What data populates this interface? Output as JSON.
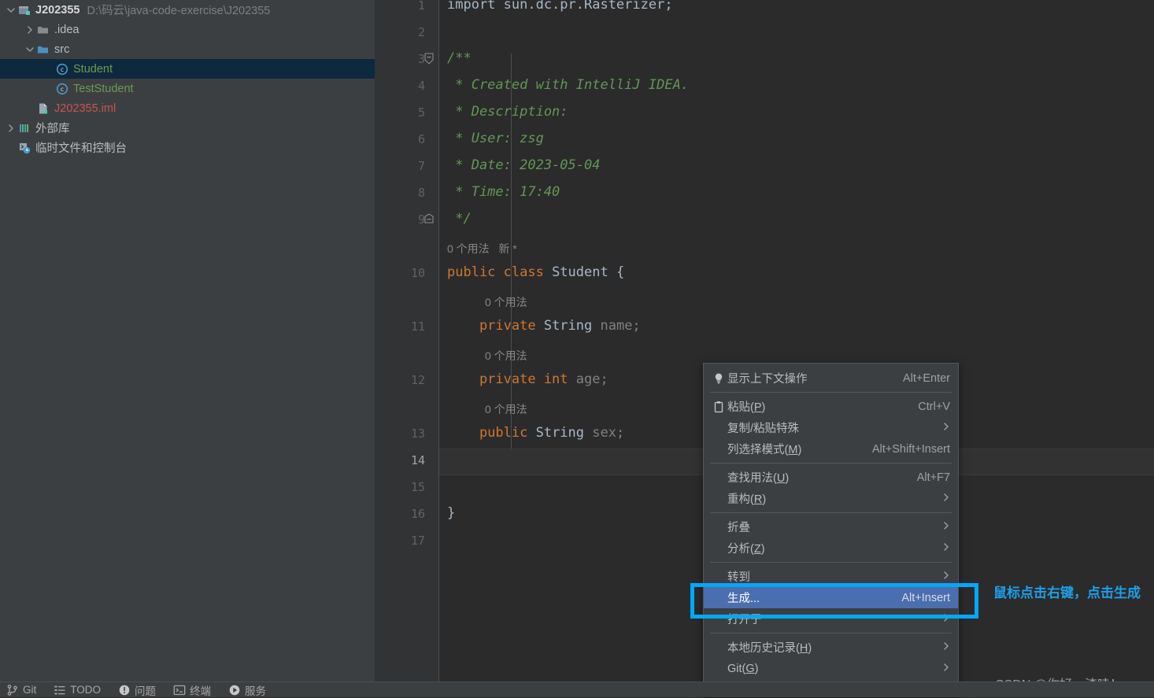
{
  "theme": {
    "editor_bg": "#2b2b2b",
    "panel_bg": "#3c3f41",
    "gutter_bg": "#313335",
    "selection_bg": "#0d293e",
    "menu_highlight": "#4b6eaf",
    "annotation_color": "#1e9fe8",
    "comment_green": "#629755",
    "keyword_orange": "#cc7832"
  },
  "sidebar": {
    "items": [
      {
        "label": "J202355",
        "sub": "D:\\码云\\java-code-exercise\\J202355",
        "icon": "module-icon",
        "arrow": "expanded",
        "indent": 0,
        "style": "bold",
        "selected": false
      },
      {
        "label": ".idea",
        "sub": "",
        "icon": "folder-icon",
        "arrow": "collapsed",
        "indent": 1,
        "style": "normal",
        "selected": false
      },
      {
        "label": "src",
        "sub": "",
        "icon": "source-folder-icon",
        "arrow": "expanded",
        "indent": 1,
        "style": "normal",
        "selected": false
      },
      {
        "label": "Student",
        "sub": "",
        "icon": "java-class-icon",
        "arrow": "none",
        "indent": 2,
        "style": "green",
        "selected": true
      },
      {
        "label": "TestStudent",
        "sub": "",
        "icon": "java-class-icon",
        "arrow": "none",
        "indent": 2,
        "style": "green",
        "selected": false
      },
      {
        "label": "J202355.iml",
        "sub": "",
        "icon": "iml-file-icon",
        "arrow": "none",
        "indent": 1,
        "style": "red",
        "selected": false
      },
      {
        "label": "外部库",
        "sub": "",
        "icon": "external-libraries-icon",
        "arrow": "collapsed",
        "indent": 0,
        "style": "normal",
        "selected": false
      },
      {
        "label": "临时文件和控制台",
        "sub": "",
        "icon": "scratches-console-icon",
        "arrow": "none",
        "indent": 0,
        "style": "normal",
        "selected": false
      }
    ]
  },
  "editor": {
    "line_numbers": [
      "1",
      "2",
      "3",
      "4",
      "5",
      "6",
      "7",
      "8",
      "9",
      "10",
      "11",
      "12",
      "13",
      "14",
      "15",
      "16",
      "17"
    ],
    "current_line": "14",
    "lines": [
      {
        "num": "1",
        "tokens": [
          {
            "t": "import sun.dc.pr.Rasterizer;",
            "c": "plain"
          }
        ]
      },
      {
        "num": "2",
        "tokens": []
      },
      {
        "num": "3",
        "tokens": [
          {
            "t": "/**",
            "c": "cmt"
          }
        ],
        "fold": "open"
      },
      {
        "num": "4",
        "tokens": [
          {
            "t": " * Created with IntelliJ IDEA.",
            "c": "cmt"
          }
        ]
      },
      {
        "num": "5",
        "tokens": [
          {
            "t": " * Description:",
            "c": "cmt"
          }
        ]
      },
      {
        "num": "6",
        "tokens": [
          {
            "t": " * User: zsg",
            "c": "cmt"
          }
        ]
      },
      {
        "num": "7",
        "tokens": [
          {
            "t": " * Date: 2023-05-04",
            "c": "cmt"
          }
        ]
      },
      {
        "num": "8",
        "tokens": [
          {
            "t": " * Time: 17:40",
            "c": "cmt"
          }
        ]
      },
      {
        "num": "9",
        "tokens": [
          {
            "t": " */",
            "c": "cmt"
          }
        ],
        "fold": "close"
      },
      {
        "num": "10",
        "tokens": [
          {
            "t": "public class ",
            "c": "kw"
          },
          {
            "t": "Student {",
            "c": "plain"
          }
        ]
      },
      {
        "num": "11",
        "tokens": [
          {
            "t": "    private ",
            "c": "kw"
          },
          {
            "t": "String ",
            "c": "plain"
          },
          {
            "t": "name;",
            "c": "dim"
          }
        ]
      },
      {
        "num": "12",
        "tokens": [
          {
            "t": "    private int ",
            "c": "kw"
          },
          {
            "t": "age;",
            "c": "dim"
          }
        ]
      },
      {
        "num": "13",
        "tokens": [
          {
            "t": "    public ",
            "c": "kw"
          },
          {
            "t": "String ",
            "c": "plain"
          },
          {
            "t": "sex;",
            "c": "dim"
          }
        ]
      },
      {
        "num": "14",
        "tokens": []
      },
      {
        "num": "15",
        "tokens": []
      },
      {
        "num": "16",
        "tokens": [
          {
            "t": "}",
            "c": "plain"
          }
        ]
      },
      {
        "num": "17",
        "tokens": []
      }
    ],
    "inlay_hints": [
      {
        "text": "0 个用法   新 *",
        "after_line": "9",
        "indent": 0
      },
      {
        "text": "0 个用法",
        "after_line": "10",
        "indent": 1
      },
      {
        "text": "0 个用法",
        "after_line": "11",
        "indent": 1
      },
      {
        "text": "0 个用法",
        "after_line": "12",
        "indent": 1
      }
    ]
  },
  "context_menu": {
    "items": [
      {
        "type": "item",
        "icon": "lightbulb-icon",
        "label": "显示上下文操作",
        "shortcut": "Alt+Enter",
        "submenu": false,
        "highlight": false
      },
      {
        "type": "separator"
      },
      {
        "type": "item",
        "icon": "clipboard-icon",
        "label": "粘贴(P)",
        "mnemonic": "P",
        "shortcut": "Ctrl+V",
        "submenu": false,
        "highlight": false
      },
      {
        "type": "item",
        "icon": "",
        "label": "复制/粘贴特殊",
        "shortcut": "",
        "submenu": true,
        "highlight": false
      },
      {
        "type": "item",
        "icon": "",
        "label": "列选择模式(M)",
        "mnemonic": "M",
        "shortcut": "Alt+Shift+Insert",
        "submenu": false,
        "highlight": false
      },
      {
        "type": "separator"
      },
      {
        "type": "item",
        "icon": "",
        "label": "查找用法(U)",
        "mnemonic": "U",
        "shortcut": "Alt+F7",
        "submenu": false,
        "highlight": false
      },
      {
        "type": "item",
        "icon": "",
        "label": "重构(R)",
        "mnemonic": "R",
        "shortcut": "",
        "submenu": true,
        "highlight": false
      },
      {
        "type": "separator"
      },
      {
        "type": "item",
        "icon": "",
        "label": "折叠",
        "shortcut": "",
        "submenu": true,
        "highlight": false
      },
      {
        "type": "item",
        "icon": "",
        "label": "分析(Z)",
        "mnemonic": "Z",
        "shortcut": "",
        "submenu": true,
        "highlight": false
      },
      {
        "type": "separator"
      },
      {
        "type": "item",
        "icon": "",
        "label": "转到",
        "shortcut": "",
        "submenu": true,
        "highlight": false
      },
      {
        "type": "item",
        "icon": "",
        "label": "生成...",
        "shortcut": "Alt+Insert",
        "submenu": false,
        "highlight": true
      },
      {
        "type": "item",
        "icon": "",
        "label": "打开于",
        "shortcut": "",
        "submenu": true,
        "highlight": false
      },
      {
        "type": "separator"
      },
      {
        "type": "item",
        "icon": "",
        "label": "本地历史记录(H)",
        "mnemonic": "H",
        "shortcut": "",
        "submenu": true,
        "highlight": false
      },
      {
        "type": "item",
        "icon": "",
        "label": "Git(G)",
        "mnemonic": "G",
        "shortcut": "",
        "submenu": true,
        "highlight": false
      },
      {
        "type": "separator"
      }
    ]
  },
  "annotation": {
    "text": "鼠标点击右键，点击生成",
    "watermark": "CSDN @你好，渣哇！"
  },
  "statusbar": {
    "items": [
      {
        "label": "Git",
        "icon": "git-branch-icon"
      },
      {
        "label": "TODO",
        "icon": "todo-list-icon"
      },
      {
        "label": "问题",
        "icon": "problems-icon"
      },
      {
        "label": "终端",
        "icon": "terminal-icon"
      },
      {
        "label": "服务",
        "icon": "services-run-icon"
      }
    ]
  }
}
